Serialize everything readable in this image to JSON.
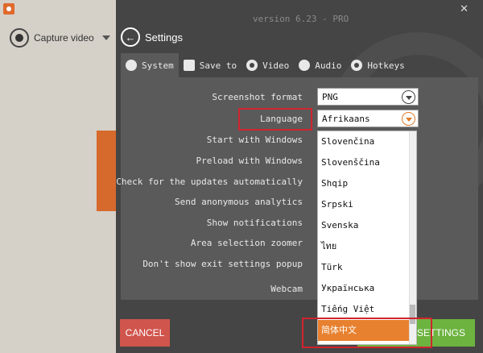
{
  "background_app": {
    "capture_label": "Capture video"
  },
  "panel": {
    "version": "version 6.23 - PRO",
    "close_glyph": "✕",
    "back_title": "Settings",
    "back_glyph": "←"
  },
  "tabs": [
    {
      "label": "System",
      "icon": "gear-icon"
    },
    {
      "label": "Save to",
      "icon": "folder-icon"
    },
    {
      "label": "Video",
      "icon": "record-icon"
    },
    {
      "label": "Audio",
      "icon": "speaker-icon"
    },
    {
      "label": "Hotkeys",
      "icon": "hotkeys-icon"
    }
  ],
  "settings": {
    "screenshot_format_label": "Screenshot format",
    "screenshot_format_value": "PNG",
    "language_label": "Language",
    "language_value": "Afrikaans",
    "start_with_windows": "Start with Windows",
    "preload_with_windows": "Preload with Windows",
    "check_updates": "Check for the updates automatically",
    "send_analytics": "Send anonymous analytics",
    "show_notifications": "Show notifications",
    "area_selection_zoomer": "Area selection zoomer",
    "dont_show_exit_popup": "Don't show exit settings popup",
    "webcam": "Webcam"
  },
  "language_dropdown": {
    "options": [
      "Slovenčina",
      "Slovenščina",
      "Shqip",
      "Srpski",
      "Svenska",
      "ไทย",
      "Türk",
      "Українська",
      "Tiếng Việt",
      "简体中文"
    ],
    "selected": "简体中文"
  },
  "footer": {
    "cancel_label": "CANCEL",
    "save_label": "SAVE SETTINGS"
  },
  "colors": {
    "accent_orange": "#e8812f",
    "cancel_red": "#d0554d",
    "save_green": "#6cb33f",
    "highlight_red": "#d0242e"
  }
}
